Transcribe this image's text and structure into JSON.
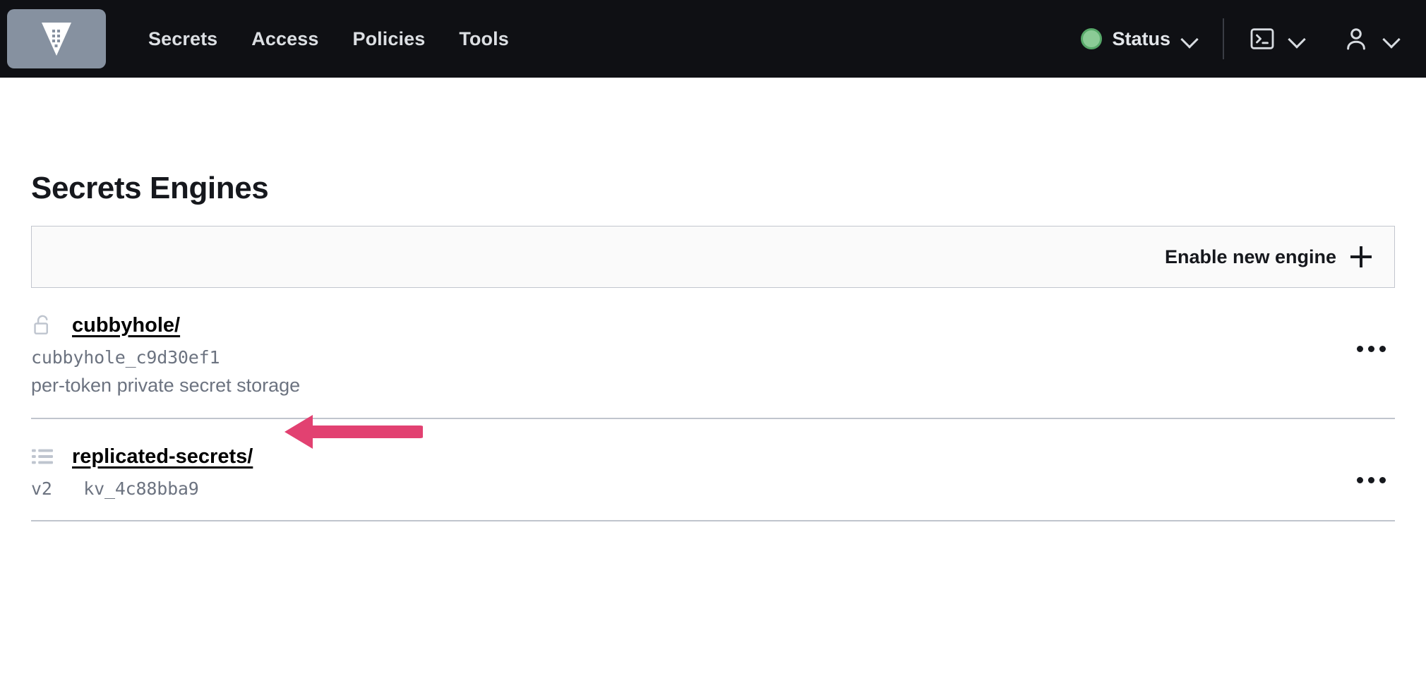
{
  "navbar": {
    "logo_name": "vault-logo",
    "links": [
      {
        "label": "Secrets"
      },
      {
        "label": "Access"
      },
      {
        "label": "Policies"
      },
      {
        "label": "Tools"
      }
    ],
    "status": {
      "label": "Status",
      "dot_color": "#8bcb96",
      "dot_ring_color": "#57a869"
    },
    "console_icon": "console-icon",
    "user_icon": "user-icon",
    "background_color": "#0f1014",
    "link_color": "#dcdfe3"
  },
  "page": {
    "title": "Secrets Engines"
  },
  "toolbar": {
    "enable_engine_label": "Enable new engine",
    "plus_icon": "plus-icon",
    "background_color": "#fafafa",
    "border_color": "#c2c6ce"
  },
  "engines": [
    {
      "icon": "unlock-icon",
      "path": "cubbyhole/",
      "accessor": "cubbyhole_c9d30ef1",
      "description": "per-token private secret storage",
      "version": "",
      "menu_label": "..."
    },
    {
      "icon": "list-icon",
      "path": "replicated-secrets/",
      "accessor": "kv_4c88bba9",
      "description": "",
      "version": "v2",
      "menu_label": "..."
    }
  ],
  "annotation": {
    "type": "arrow",
    "direction": "left",
    "color": "#e24171",
    "points_at": "replicated-secrets/"
  }
}
